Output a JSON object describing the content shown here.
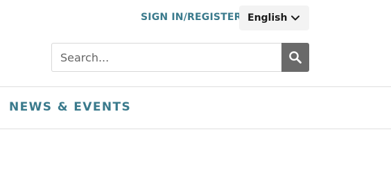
{
  "header": {
    "signin_label": "SIGN IN/REGISTER",
    "language": {
      "selected": "English",
      "icon": "chevron-down-icon"
    }
  },
  "search": {
    "placeholder": "Search...",
    "value": "",
    "button_icon": "search-icon"
  },
  "nav": {
    "section_label": "NEWS & EVENTS"
  },
  "colors": {
    "accent": "#3a7a8c",
    "search_button": "#6a6a6a",
    "language_bg": "#f3f3f3"
  }
}
